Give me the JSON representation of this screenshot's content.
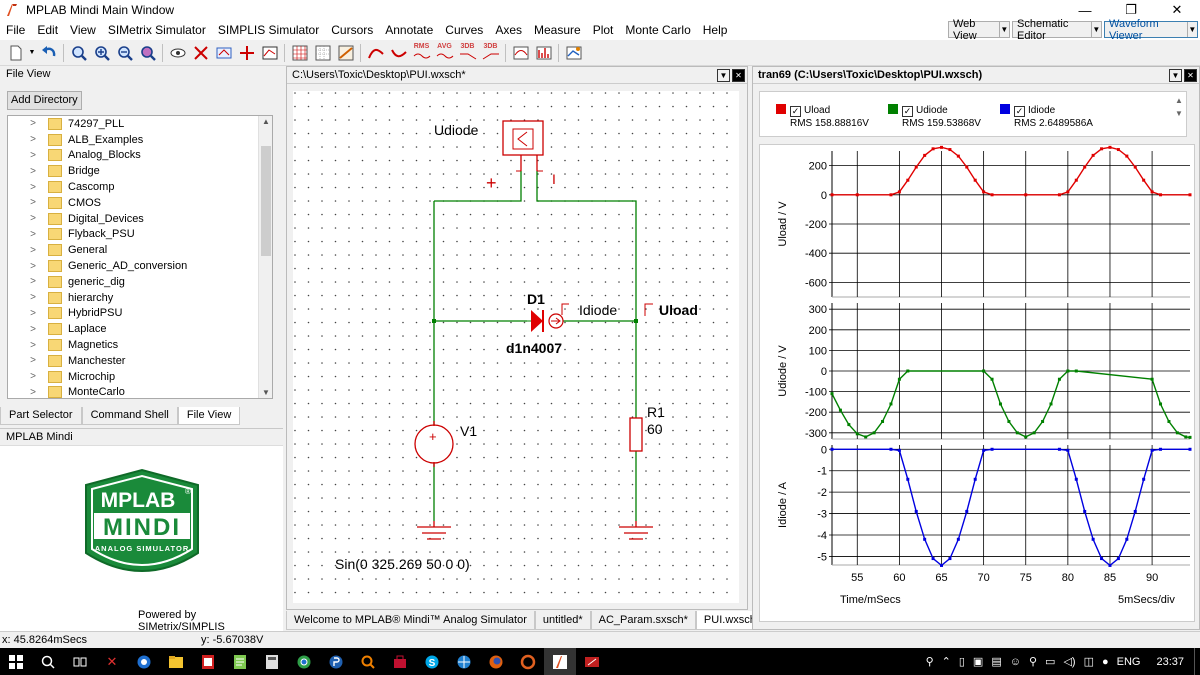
{
  "window": {
    "title": "MPLAB Mindi Main Window"
  },
  "menu": [
    "File",
    "Edit",
    "View",
    "SIMetrix Simulator",
    "SIMPLIS Simulator",
    "Cursors",
    "Annotate",
    "Curves",
    "Axes",
    "Measure",
    "Plot",
    "Monte Carlo",
    "Help"
  ],
  "view_switch": {
    "web": "Web View",
    "schematic": "Schematic Editor",
    "waveform": "Waveform Viewer"
  },
  "toolbar_text": {
    "rms": "RMS",
    "avg": "AVG",
    "db1": "3DB",
    "db2": "3DB"
  },
  "file_view": {
    "title": "File View",
    "add_button": "Add Directory",
    "folders": [
      "74297_PLL",
      "ALB_Examples",
      "Analog_Blocks",
      "Bridge",
      "Cascomp",
      "CMOS",
      "Digital_Devices",
      "Flyback_PSU",
      "General",
      "Generic_AD_conversion",
      "generic_dig",
      "hierarchy",
      "HybridPSU",
      "Laplace",
      "Magnetics",
      "Manchester",
      "Microchip",
      "MonteCarlo"
    ]
  },
  "left_tabs": [
    "Part Selector",
    "Command Shell",
    "File View"
  ],
  "mindi": {
    "title": "MPLAB Mindi",
    "logo_top": "MPLAB",
    "logo_reg": "®",
    "logo_mid": "MINDI",
    "logo_sub": "ANALOG SIMULATOR",
    "powered": "Powered by SIMetrix/SIMPLIS"
  },
  "schematic": {
    "path": "C:\\Users\\Toxic\\Desktop\\PUI.wxsch*",
    "probe_label": "Udiode",
    "plus": "+",
    "minus": "I",
    "diode_ref": "D1",
    "diode_model": "d1n4007",
    "current_probe": "Idiode",
    "voltage_probe": "Uload",
    "source_ref": "V1",
    "source_plus": "+",
    "res_ref": "R1",
    "res_val": "60",
    "source_expr": "Sin(0 325.269 50 0 0)"
  },
  "bottom_tabs": [
    "Welcome to MPLAB® Mindi™ Analog Simulator",
    "untitled*",
    "AC_Param.sxsch*",
    "PUI.wxsch*"
  ],
  "waveform": {
    "title": "tran69 (C:\\Users\\Toxic\\Desktop\\PUI.wxsch)",
    "legend": [
      {
        "name": "Uload",
        "rms": "RMS  158.88816V",
        "color": "#e00000"
      },
      {
        "name": "Udiode",
        "rms": "RMS  159.53868V",
        "color": "#008000"
      },
      {
        "name": "Idiode",
        "rms": "RMS  2.6489586A",
        "color": "#0000e0"
      }
    ],
    "check": "✓",
    "xlabel": "Time/mSecs",
    "xdiv": "5mSecs/div"
  },
  "chart_data": [
    {
      "type": "line",
      "ylabel": "Uload / V",
      "yticks": [
        200,
        0,
        -200,
        -400,
        -600
      ],
      "ylim": [
        -700,
        300
      ],
      "xlim": [
        52,
        94.5
      ],
      "xticks": [
        55,
        60,
        65,
        70,
        75,
        80,
        85,
        90
      ],
      "series": [
        {
          "name": "Uload",
          "color": "#e00000",
          "x": [
            52,
            55,
            59,
            60,
            61,
            62,
            63,
            64,
            65,
            66,
            67,
            68,
            69,
            70,
            71,
            75,
            79,
            80,
            81,
            82,
            83,
            84,
            85,
            86,
            87,
            88,
            89,
            90,
            91,
            94.5
          ],
          "y": [
            0,
            0,
            0,
            20,
            100,
            190,
            270,
            315,
            325,
            310,
            265,
            190,
            100,
            20,
            0,
            0,
            0,
            20,
            100,
            190,
            270,
            315,
            325,
            310,
            265,
            190,
            100,
            20,
            0,
            0
          ]
        }
      ]
    },
    {
      "type": "line",
      "ylabel": "Udiode / V",
      "yticks": [
        300,
        200,
        100,
        0,
        -100,
        -200,
        -300
      ],
      "ylim": [
        -330,
        330
      ],
      "xlim": [
        52,
        94.5
      ],
      "xticks": [
        55,
        60,
        65,
        70,
        75,
        80,
        85,
        90
      ],
      "series": [
        {
          "name": "Udiode",
          "color": "#008000",
          "x": [
            52,
            53,
            54,
            55,
            56,
            57,
            58,
            59,
            60,
            61,
            70,
            71,
            72,
            73,
            74,
            75,
            76,
            77,
            78,
            79,
            80,
            81,
            90,
            91,
            92,
            93,
            94,
            94.5
          ],
          "y": [
            -110,
            -190,
            -260,
            -305,
            -320,
            -300,
            -245,
            -160,
            -40,
            0,
            0,
            -40,
            -160,
            -245,
            -300,
            -320,
            -300,
            -245,
            -160,
            -40,
            0,
            0,
            -40,
            -160,
            -245,
            -300,
            -320,
            -322
          ]
        }
      ]
    },
    {
      "type": "line",
      "ylabel": "Idiode / A",
      "yticks": [
        0,
        -1,
        -2,
        -3,
        -4,
        -5
      ],
      "ylim": [
        -5.4,
        0.2
      ],
      "xlim": [
        52,
        94.5
      ],
      "xticks": [
        55,
        60,
        65,
        70,
        75,
        80,
        85,
        90
      ],
      "series": [
        {
          "name": "Idiode",
          "color": "#0000e0",
          "x": [
            52,
            59,
            60,
            61,
            62,
            63,
            64,
            65,
            66,
            67,
            68,
            69,
            70,
            71,
            79,
            80,
            81,
            82,
            83,
            84,
            85,
            86,
            87,
            88,
            89,
            90,
            91,
            94.5
          ],
          "y": [
            0,
            0,
            -0.05,
            -1.4,
            -2.9,
            -4.2,
            -5.1,
            -5.42,
            -5.1,
            -4.2,
            -2.9,
            -1.4,
            -0.05,
            0,
            0,
            -0.05,
            -1.4,
            -2.9,
            -4.2,
            -5.1,
            -5.42,
            -5.1,
            -4.2,
            -2.9,
            -1.4,
            -0.05,
            0,
            0
          ]
        }
      ]
    }
  ],
  "status": {
    "x": "x: 45.8264mSecs",
    "y": "y: -5.67038V"
  },
  "taskbar": {
    "lang": "ENG",
    "time": "23:37"
  }
}
